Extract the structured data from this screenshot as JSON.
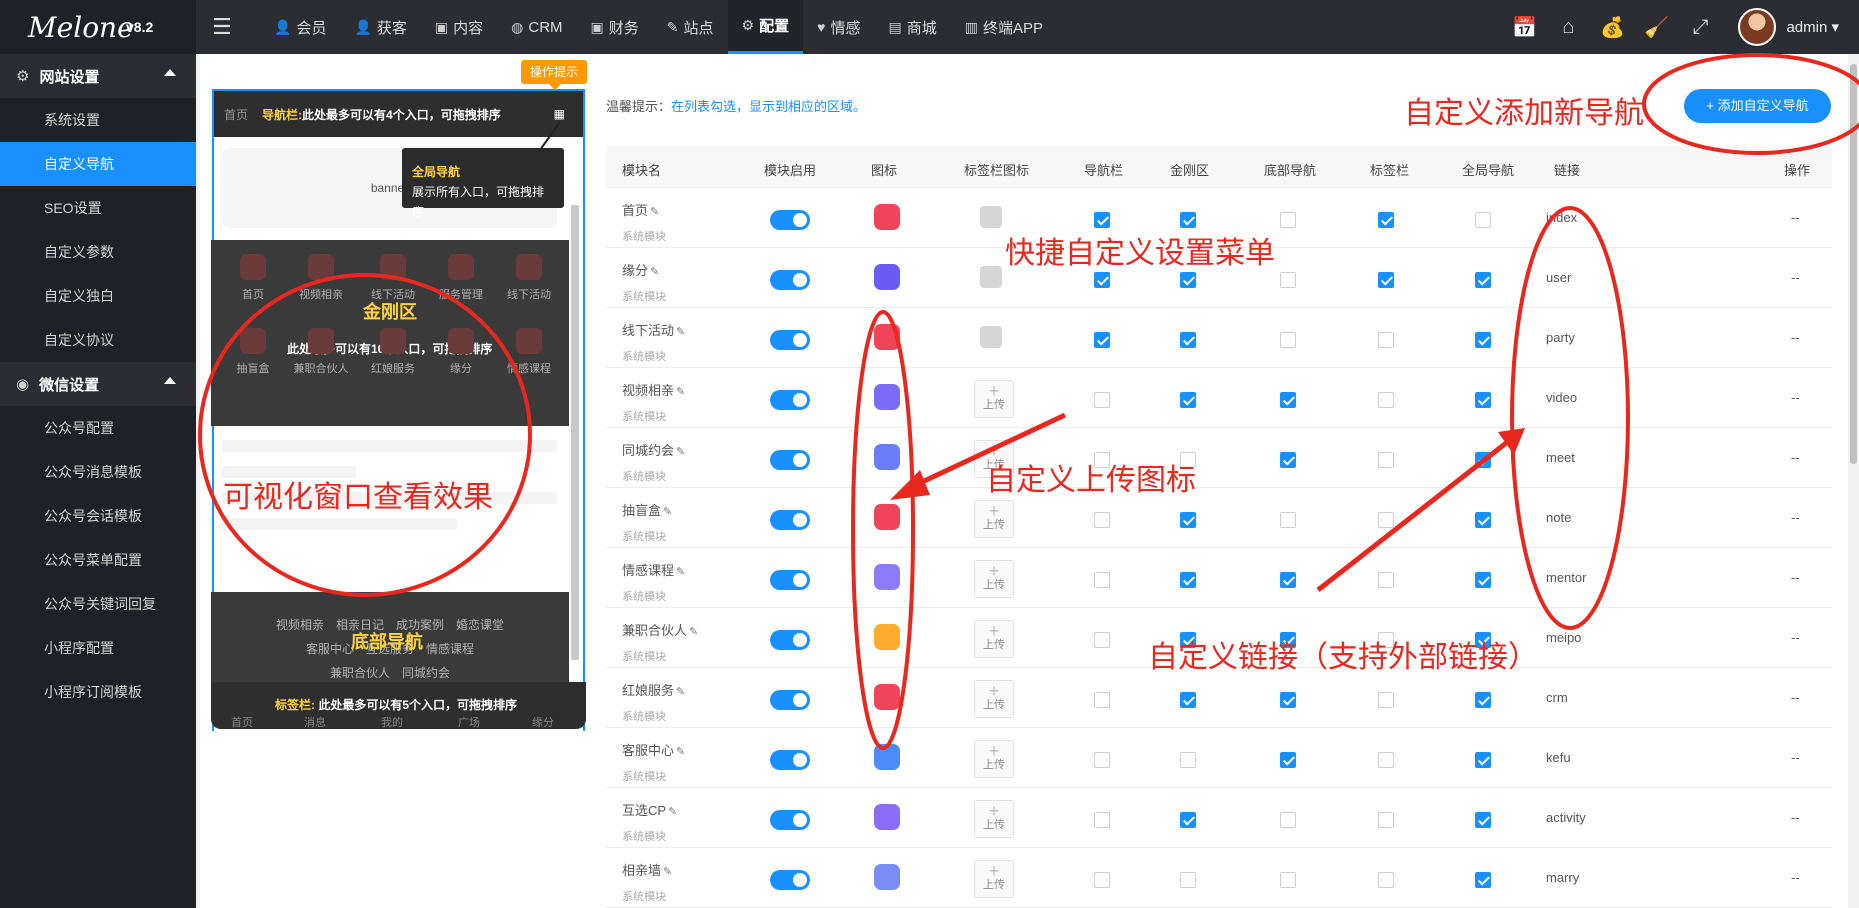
{
  "app": {
    "logo": "Melone",
    "version": "v8.2"
  },
  "topnav": [
    {
      "icon": "user-icon",
      "glyph": "👤",
      "label": "会员"
    },
    {
      "icon": "acquire-icon",
      "glyph": "👤",
      "label": "获客"
    },
    {
      "icon": "content-icon",
      "glyph": "▣",
      "label": "内容"
    },
    {
      "icon": "crm-icon",
      "glyph": "◍",
      "label": "CRM"
    },
    {
      "icon": "finance-icon",
      "glyph": "▣",
      "label": "财务"
    },
    {
      "icon": "site-icon",
      "glyph": "✎",
      "label": "站点"
    },
    {
      "icon": "config-icon",
      "glyph": "⚙",
      "label": "配置",
      "active": true
    },
    {
      "icon": "heart-icon",
      "glyph": "♥",
      "label": "情感"
    },
    {
      "icon": "shop-icon",
      "glyph": "▤",
      "label": "商城"
    },
    {
      "icon": "terminal-icon",
      "glyph": "▥",
      "label": "终端APP"
    }
  ],
  "user": {
    "name": "admin"
  },
  "sidebar": {
    "groups": [
      {
        "label": "网站设置",
        "icon": "gear-icon",
        "items": [
          "系统设置",
          "自定义导航",
          "SEO设置",
          "自定义参数",
          "自定义独白",
          "自定义协议"
        ]
      },
      {
        "label": "微信设置",
        "icon": "wechat-icon",
        "items": [
          "公众号配置",
          "公众号消息模板",
          "公众号会话模板",
          "公众号菜单配置",
          "公众号关键词回复",
          "小程序配置",
          "小程序订阅模板"
        ]
      }
    ],
    "active": "自定义导航"
  },
  "preview": {
    "tip_badge": "操作提示",
    "nav_home": "首页",
    "nav_label": "导航栏:",
    "nav_desc": "此处最多可以有4个入口，可拖拽排序",
    "banner": "banner",
    "global_title": "全局导航",
    "global_desc": "展示所有入口，可拖拽排序",
    "gold_title": "金刚区",
    "gold_desc": "此处最多可以有10个入口，可拖拽排序",
    "gold_items": [
      "首页",
      "视频相亲",
      "线下活动",
      "服务管理",
      "线下活动",
      "抽盲盒",
      "兼职合伙人",
      "红娘服务",
      "缘分",
      "情感课程"
    ],
    "bottom_title": "底部导航",
    "bottom_lines": [
      "视频相亲　相亲日记　成功案例　婚恋课堂",
      "客服中心　互选服务　情感课程",
      "兼职合伙人　同城约会"
    ],
    "tab_label": "标签栏:",
    "tab_desc": "此处最多可以有5个入口，可拖拽排序",
    "tab_items": [
      "首页",
      "消息",
      "我的",
      "广场",
      "缘分"
    ]
  },
  "tips": {
    "prefix": "温馨提示：",
    "text": "在列表勾选，显示到相应的区域。"
  },
  "add_button": "+ 添加自定义导航",
  "table": {
    "headers": [
      "模块名",
      "模块启用",
      "图标",
      "标签栏图标",
      "导航栏",
      "金刚区",
      "底部导航",
      "标签栏",
      "全局导航",
      "链接",
      "操作"
    ],
    "sub_label": "系统模块",
    "upload_label": "上传",
    "op": "--",
    "rows": [
      {
        "name": "首页",
        "icon_color": "#f0445a",
        "tab_icon": true,
        "nav": true,
        "gold": true,
        "bottom": false,
        "tab": true,
        "global": false,
        "link": "index"
      },
      {
        "name": "缘分",
        "icon_color": "#6a5cf6",
        "tab_icon": true,
        "nav": true,
        "gold": true,
        "bottom": false,
        "tab": true,
        "global": true,
        "link": "user"
      },
      {
        "name": "线下活动",
        "icon_color": "#f0445a",
        "tab_icon": true,
        "nav": true,
        "gold": true,
        "bottom": false,
        "tab": false,
        "global": true,
        "link": "party"
      },
      {
        "name": "视频相亲",
        "icon_color": "#7b6cf6",
        "tab_icon": false,
        "nav": false,
        "gold": true,
        "bottom": true,
        "tab": false,
        "global": true,
        "link": "video"
      },
      {
        "name": "同城约会",
        "icon_color": "#6a7cf6",
        "tab_icon": false,
        "nav": false,
        "gold": false,
        "bottom": true,
        "tab": false,
        "global": true,
        "link": "meet"
      },
      {
        "name": "抽盲盒",
        "icon_color": "#f0445a",
        "tab_icon": false,
        "nav": false,
        "gold": true,
        "bottom": false,
        "tab": false,
        "global": true,
        "link": "note"
      },
      {
        "name": "情感课程",
        "icon_color": "#8a7cf6",
        "tab_icon": false,
        "nav": false,
        "gold": true,
        "bottom": true,
        "tab": false,
        "global": true,
        "link": "mentor"
      },
      {
        "name": "兼职合伙人",
        "icon_color": "#ffab2e",
        "tab_icon": false,
        "nav": false,
        "gold": true,
        "bottom": true,
        "tab": false,
        "global": true,
        "link": "meipo"
      },
      {
        "name": "红娘服务",
        "icon_color": "#f0445a",
        "tab_icon": false,
        "nav": false,
        "gold": true,
        "bottom": true,
        "tab": false,
        "global": true,
        "link": "crm"
      },
      {
        "name": "客服中心",
        "icon_color": "#4b8cf6",
        "tab_icon": false,
        "nav": false,
        "gold": false,
        "bottom": true,
        "tab": false,
        "global": true,
        "link": "kefu"
      },
      {
        "name": "互选CP",
        "icon_color": "#8a6cf6",
        "tab_icon": false,
        "nav": false,
        "gold": true,
        "bottom": false,
        "tab": false,
        "global": true,
        "link": "activity"
      },
      {
        "name": "相亲墙",
        "icon_color": "#7b8cf6",
        "tab_icon": false,
        "nav": false,
        "gold": false,
        "bottom": false,
        "tab": false,
        "global": true,
        "link": "marry"
      }
    ]
  },
  "annotations": {
    "add_nav": "自定义添加新导航",
    "quick_menu": "快捷自定义设置菜单",
    "preview": "可视化窗口查看效果",
    "upload_icon": "自定义上传图标",
    "custom_link": "自定义链接（支持外部链接）"
  },
  "colors": {
    "accent": "#1890ff",
    "annotation": "#e8281f",
    "highlight": "#ffd33d"
  }
}
